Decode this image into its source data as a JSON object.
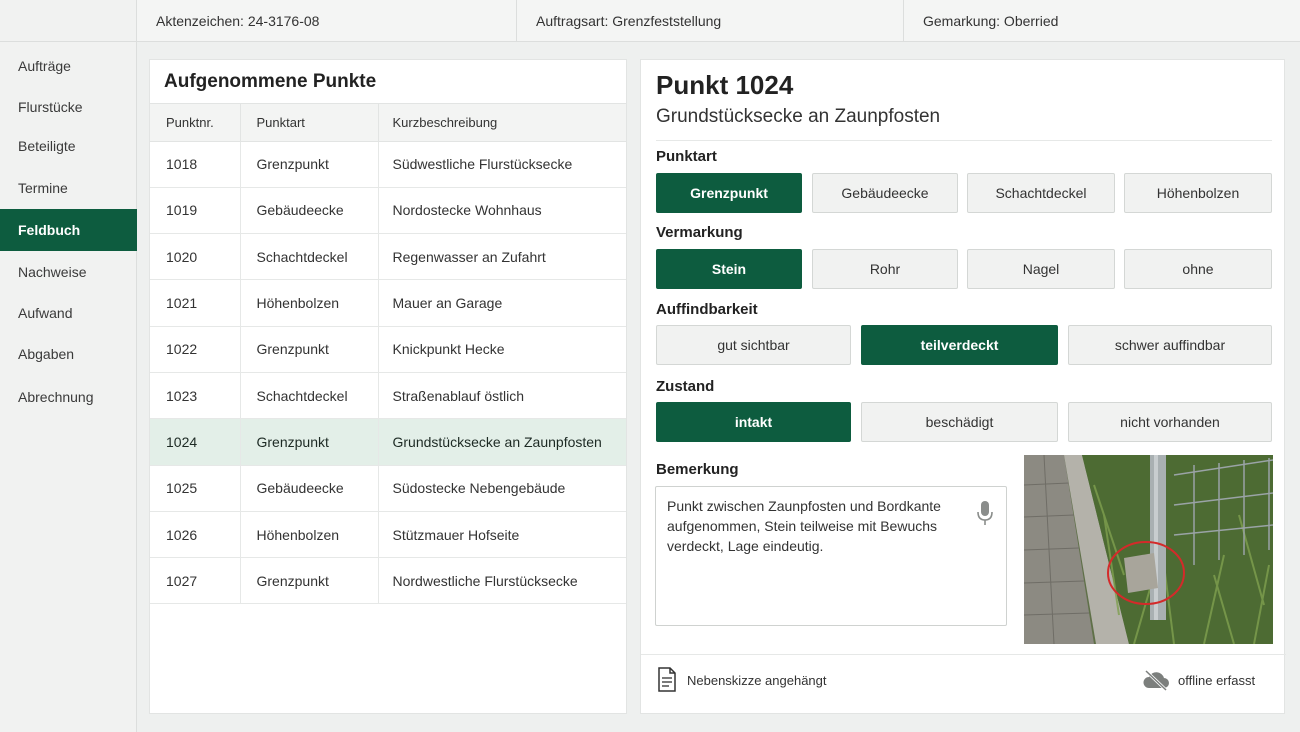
{
  "header": {
    "aktenzeichen": "Aktenzeichen: 24-3176-08",
    "auftragsart": "Auftragsart: Grenzfeststellung",
    "gemarkung": "Gemarkung: Oberried"
  },
  "sidebar": {
    "items": [
      {
        "label": "Aufträge"
      },
      {
        "label": "Flurstücke"
      },
      {
        "label": "Beteiligte"
      },
      {
        "label": "Termine"
      },
      {
        "label": "Feldbuch",
        "active": true
      },
      {
        "label": "Nachweise"
      },
      {
        "label": "Aufwand"
      },
      {
        "label": "Abgaben"
      },
      {
        "label": "Abrechnung"
      }
    ]
  },
  "list": {
    "title": "Aufgenommene Punkte",
    "columns": [
      "Punktnr.",
      "Punktart",
      "Kurzbeschreibung"
    ],
    "rows": [
      [
        "1018",
        "Grenzpunkt",
        "Südwestliche Flurstücksecke"
      ],
      [
        "1019",
        "Gebäudeecke",
        "Nordostecke Wohnhaus"
      ],
      [
        "1020",
        "Schachtdeckel",
        "Regenwasser an Zufahrt"
      ],
      [
        "1021",
        "Höhenbolzen",
        "Mauer an Garage"
      ],
      [
        "1022",
        "Grenzpunkt",
        "Knickpunkt Hecke"
      ],
      [
        "1023",
        "Schachtdeckel",
        "Straßenablauf östlich"
      ],
      [
        "1024",
        "Grenzpunkt",
        "Grundstücksecke an Zaunpfosten"
      ],
      [
        "1025",
        "Gebäudeecke",
        "Südostecke Nebengebäude"
      ],
      [
        "1026",
        "Höhenbolzen",
        "Stützmauer Hofseite"
      ],
      [
        "1027",
        "Grenzpunkt",
        "Nordwestliche Flurstücksecke"
      ]
    ],
    "selected_index": 6
  },
  "detail": {
    "title": "Punkt 1024",
    "subtitle": "Grundstücksecke an Zaunpfosten",
    "punktart": {
      "label": "Punktart",
      "options": [
        "Grenzpunkt",
        "Gebäudeecke",
        "Schachtdeckel",
        "Höhenbolzen"
      ],
      "selected": "Grenzpunkt"
    },
    "vermarkung": {
      "label": "Vermarkung",
      "options": [
        "Stein",
        "Rohr",
        "Nagel",
        "ohne"
      ],
      "selected": "Stein"
    },
    "auffindbarkeit": {
      "label": "Auffindbarkeit",
      "options": [
        "gut sichtbar",
        "teilverdeckt",
        "schwer auffindbar"
      ],
      "selected": "teilverdeckt"
    },
    "zustand": {
      "label": "Zustand",
      "options": [
        "intakt",
        "beschädigt",
        "nicht vorhanden"
      ],
      "selected": "intakt"
    },
    "bemerkung_label": "Bemerkung",
    "bemerkung_text": "Punkt zwischen Zaunpfosten und Bordkante aufgenommen, Stein teilweise mit Bewuchs verdeckt, Lage eindeutig.",
    "sketch_text": "Nebenskizze angehängt",
    "offline_text": "offline erfasst"
  },
  "colors": {
    "accent": "#0d5c3f",
    "selected_row": "#e3efe8"
  }
}
